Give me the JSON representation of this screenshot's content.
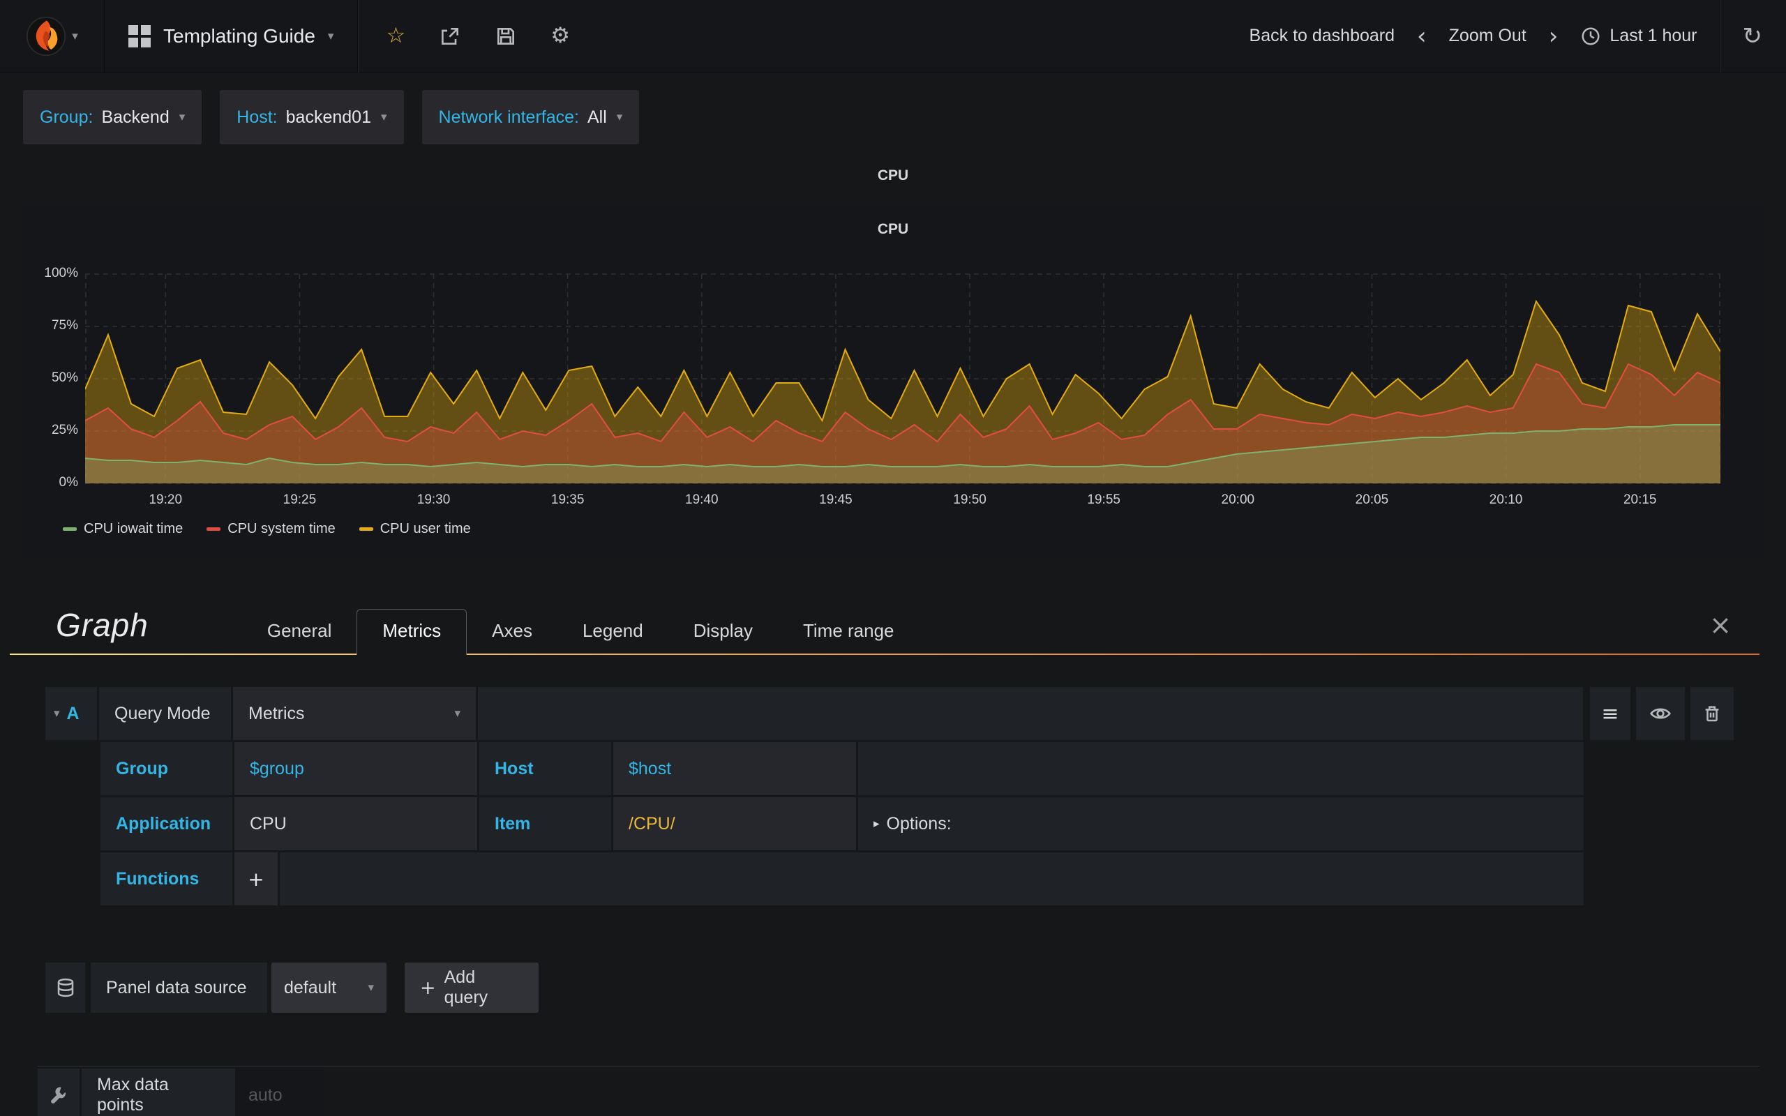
{
  "navbar": {
    "title": "Templating Guide",
    "back": "Back to dashboard",
    "zoom_out": "Zoom Out",
    "time_range": "Last 1 hour"
  },
  "icons": {
    "star": "☆",
    "gear": "⚙",
    "refresh": "↻",
    "menu": "≡",
    "caret_down": "▾",
    "caret_right": "▸",
    "chevron_left": "‹",
    "chevron_right": "›",
    "close": "×",
    "plus": "+"
  },
  "variables": [
    {
      "label": "Group:",
      "value": "Backend"
    },
    {
      "label": "Host:",
      "value": "backend01"
    },
    {
      "label": "Network interface:",
      "value": "All"
    }
  ],
  "panel": {
    "header_title": "CPU"
  },
  "chart_data": {
    "type": "area",
    "stacked": true,
    "title": "CPU",
    "xlabel": "",
    "ylabel": "",
    "ylim": [
      0,
      100
    ],
    "grid": true,
    "legend_position": "bottom-left",
    "x_start": "19:17",
    "x_end": "20:18",
    "y_ticks": [
      {
        "v": 0,
        "label": "0%"
      },
      {
        "v": 25,
        "label": "25%"
      },
      {
        "v": 50,
        "label": "50%"
      },
      {
        "v": 75,
        "label": "75%"
      },
      {
        "v": 100,
        "label": "100%"
      }
    ],
    "x_tick_labels": [
      "19:20",
      "19:25",
      "19:30",
      "19:35",
      "19:40",
      "19:45",
      "19:50",
      "19:55",
      "20:00",
      "20:05",
      "20:10",
      "20:15"
    ],
    "series": [
      {
        "name": "CPU iowait time",
        "color": "#7eb26d",
        "fill_opacity": 0.35,
        "values": [
          12,
          11,
          11,
          10,
          10,
          11,
          10,
          9,
          12,
          10,
          9,
          9,
          10,
          9,
          9,
          8,
          9,
          10,
          9,
          8,
          9,
          9,
          8,
          9,
          8,
          8,
          9,
          8,
          9,
          8,
          8,
          9,
          8,
          8,
          9,
          8,
          8,
          8,
          9,
          8,
          8,
          9,
          8,
          8,
          8,
          9,
          8,
          8,
          10,
          12,
          14,
          15,
          16,
          17,
          18,
          19,
          20,
          21,
          22,
          22,
          23,
          24,
          24,
          25,
          25,
          26,
          26,
          27,
          27,
          28,
          28,
          28
        ]
      },
      {
        "name": "CPU system time",
        "color": "#e24d42",
        "fill_opacity": 0.32,
        "values": [
          18,
          25,
          15,
          12,
          20,
          28,
          14,
          12,
          16,
          22,
          12,
          18,
          26,
          13,
          11,
          19,
          15,
          24,
          12,
          17,
          14,
          21,
          30,
          13,
          16,
          12,
          25,
          14,
          18,
          12,
          22,
          15,
          12,
          26,
          17,
          13,
          20,
          12,
          24,
          14,
          18,
          28,
          13,
          16,
          21,
          12,
          15,
          25,
          30,
          14,
          12,
          18,
          15,
          12,
          10,
          14,
          11,
          13,
          10,
          12,
          14,
          10,
          12,
          32,
          28,
          12,
          10,
          30,
          25,
          14,
          25,
          20
        ]
      },
      {
        "name": "CPU user time",
        "color": "#e5ac0e",
        "fill_opacity": 0.38,
        "values": [
          15,
          35,
          12,
          10,
          25,
          20,
          10,
          12,
          30,
          15,
          10,
          24,
          28,
          10,
          12,
          26,
          14,
          20,
          10,
          28,
          12,
          24,
          18,
          10,
          22,
          12,
          20,
          10,
          26,
          12,
          18,
          24,
          10,
          30,
          14,
          10,
          26,
          12,
          22,
          10,
          24,
          20,
          12,
          28,
          14,
          10,
          22,
          18,
          40,
          12,
          10,
          24,
          14,
          10,
          8,
          20,
          10,
          16,
          8,
          14,
          22,
          8,
          16,
          30,
          18,
          10,
          8,
          28,
          30,
          12,
          28,
          15
        ]
      }
    ]
  },
  "editor": {
    "panel_type_label": "Graph",
    "tabs": [
      "General",
      "Metrics",
      "Axes",
      "Legend",
      "Display",
      "Time range"
    ],
    "active_tab": "Metrics",
    "query": {
      "ref": "A",
      "mode_label": "Query Mode",
      "mode_value": "Metrics",
      "group_label": "Group",
      "group_value": "$group",
      "host_label": "Host",
      "host_value": "$host",
      "application_label": "Application",
      "application_value": "CPU",
      "item_label": "Item",
      "item_value": "/CPU/",
      "options_label": "Options:",
      "functions_label": "Functions"
    },
    "datasource": {
      "label": "Panel data source",
      "value": "default",
      "add_query_label": "Add query"
    },
    "max_data_points": {
      "label": "Max data points",
      "placeholder": "auto"
    }
  },
  "colors": {
    "accent_cyan": "#33b5e5",
    "query_gold": "#eab839",
    "tab_gradient_start": "#ffe47e",
    "tab_gradient_end": "#e06c1e"
  }
}
